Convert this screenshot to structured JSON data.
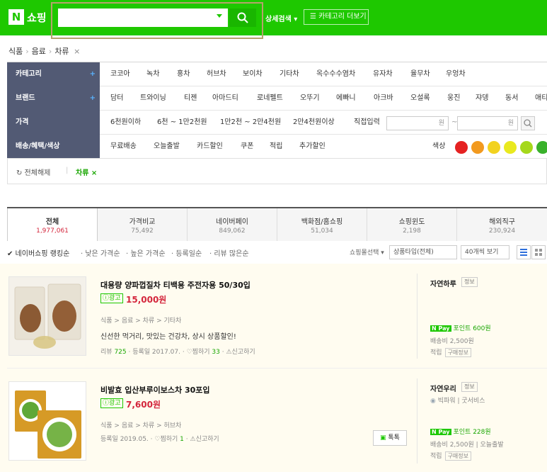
{
  "header": {
    "logo_mark": "N",
    "logo_text": "쇼핑",
    "advanced": "상세검색 ▾",
    "category_more": "☰ 카테고리 더보기"
  },
  "breadcrumb": {
    "items": [
      "식품",
      "음료",
      "차류"
    ],
    "close": "×"
  },
  "filters": {
    "category": {
      "label": "카테고리",
      "plus": "+",
      "options": [
        "코코아",
        "녹차",
        "홍차",
        "허브차",
        "보이차",
        "기타차",
        "옥수수수염차",
        "유자차",
        "율무차",
        "우엉차"
      ]
    },
    "brand": {
      "label": "브랜드",
      "plus": "+",
      "options": [
        "담터",
        "트와이닝",
        "티젠",
        "아마드티",
        "로네펠트",
        "오뚜기",
        "에빠니",
        "아크바",
        "오설록",
        "웅진",
        "쟈뎅",
        "동서",
        "애티"
      ]
    },
    "price": {
      "label": "가격",
      "options": [
        "6천원이하",
        "6천 ~ 1만2천원",
        "1만2천 ~ 2만4천원",
        "2만4천원이상"
      ],
      "direct": "직접입력",
      "unit": "원",
      "tilde": "~"
    },
    "delivery": {
      "label": "배송/혜택/색상",
      "options": [
        "무료배송",
        "오늘출발",
        "카드할인",
        "쿠폰",
        "적립",
        "추가할인"
      ],
      "color_label": "색상",
      "colors": [
        "#e52222",
        "#f29a1f",
        "#f2d21f",
        "#e9e91f",
        "#a5d81b",
        "#39b12b"
      ]
    }
  },
  "selected": {
    "reset": "↻ 전체해제",
    "chip": "차류 ×"
  },
  "tabs": [
    {
      "label": "전체",
      "count": "1,977,061"
    },
    {
      "label": "가격비교",
      "count": "75,492"
    },
    {
      "label": "네이버페이",
      "count": "849,062"
    },
    {
      "label": "백화점/홈쇼핑",
      "count": "51,034"
    },
    {
      "label": "쇼핑윈도",
      "count": "2,198"
    },
    {
      "label": "해외직구",
      "count": "230,924"
    }
  ],
  "sort": {
    "items": [
      "✔ 네이버쇼핑 랭킹순",
      "· 낮은 가격순",
      "· 높은 가격순",
      "· 등록일순",
      "· 리뷰 많은순"
    ],
    "mall_select": "쇼핑몰선택 ▾",
    "type_select": "상품타입(전체)",
    "view_select": "40개씩 보기"
  },
  "products": [
    {
      "title": "대용량 양파껍질차 티백용 주전자용 50/30입",
      "ad": "ⓘ광고",
      "price": "15,000원",
      "category": "식품 > 음료 > 차류 > 기타차",
      "desc": "신선한 먹거리, 맛있는 건강차, 상시 상품할인!",
      "review_label": "리뷰",
      "review_count": "725",
      "date": "등록일 2017.07.",
      "wish_label": "찜하기",
      "wish_count": "33",
      "report": "신고하기",
      "mall": "자연하루",
      "info": "정보",
      "npay": "N Pay",
      "point": "포인트 600원",
      "shipping": "배송비 2,500원",
      "accrual": "적립",
      "accrual_tag": "구매정보"
    },
    {
      "title": "비발효 입산부루이보스차 30포입",
      "ad": "ⓘ광고",
      "price": "7,600원",
      "category": "식품 > 음료 > 차류 > 허브차",
      "date": "등록일 2019.05.",
      "wish_label": "찜하기",
      "wish_count": "1",
      "report": "신고하기",
      "talk": "톡톡",
      "mall": "자연우리",
      "info": "정보",
      "badge": "빅파워",
      "badge2": "굿서비스",
      "npay": "N Pay",
      "point": "포인트 228원",
      "shipping": "배송비 2,500원",
      "today": "오늘출발",
      "accrual": "적립",
      "accrual_tag": "구매정보"
    }
  ]
}
